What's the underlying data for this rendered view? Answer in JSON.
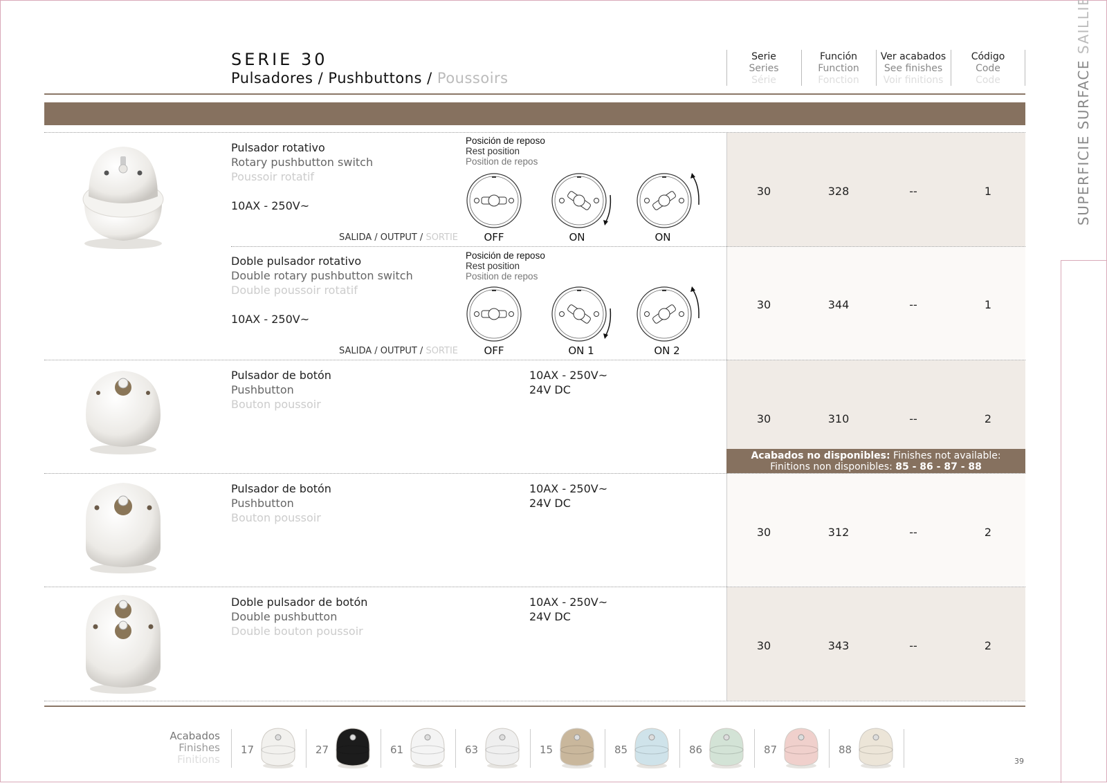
{
  "header": {
    "title": "SERIE 30",
    "subtitle_es": "Pulsadores",
    "subtitle_en": "Pushbuttons",
    "subtitle_fr": "Poussoirs",
    "sep": " / "
  },
  "columns": [
    {
      "es": "Serie",
      "en": "Series",
      "fr": "Série"
    },
    {
      "es": "Función",
      "en": "Function",
      "fr": "Fonction"
    },
    {
      "es": "Ver acabados",
      "en": "See finishes",
      "fr": "Voir finitions"
    },
    {
      "es": "Código",
      "en": "Code",
      "fr": "Code"
    }
  ],
  "side_label": {
    "es": "SUPERFICIE",
    "en": "SURFACE",
    "fr": "SAILLIE"
  },
  "rest_position": {
    "es": "Posición de reposo",
    "en": "Rest position",
    "fr": "Position de repos"
  },
  "output_label": {
    "es": "SALIDA",
    "en": "OUTPUT",
    "fr": "SORTIE"
  },
  "products": [
    {
      "es": "Pulsador rotativo",
      "en": "Rotary pushbutton switch",
      "fr": "Poussoir rotatif",
      "rating": "10AX - 250V~",
      "positions": [
        "OFF",
        "ON",
        "ON"
      ],
      "serie": "30",
      "funcion": "328",
      "acabados": "--",
      "codigo": "1"
    },
    {
      "es": "Doble pulsador rotativo",
      "en": "Double rotary pushbutton switch",
      "fr": "Double poussoir rotatif",
      "rating": "10AX - 250V~",
      "positions": [
        "OFF",
        "ON 1",
        "ON 2"
      ],
      "serie": "30",
      "funcion": "344",
      "acabados": "--",
      "codigo": "1"
    },
    {
      "es": "Pulsador de botón",
      "en": "Pushbutton",
      "fr": "Bouton poussoir",
      "spec1": "10AX - 250V~",
      "spec2": "24V DC",
      "serie": "30",
      "funcion": "310",
      "acabados": "--",
      "codigo": "2"
    },
    {
      "es": "Pulsador de botón",
      "en": "Pushbutton",
      "fr": "Bouton poussoir",
      "spec1": "10AX - 250V~",
      "spec2": "24V DC",
      "serie": "30",
      "funcion": "312",
      "acabados": "--",
      "codigo": "2"
    },
    {
      "es": "Doble pulsador de botón",
      "en": "Double pushbutton",
      "fr": "Double bouton poussoir",
      "spec1": "10AX - 250V~",
      "spec2": "24V DC",
      "serie": "30",
      "funcion": "343",
      "acabados": "--",
      "codigo": "2"
    }
  ],
  "note": {
    "bold1": "Acabados no disponibles:",
    "text1": " Finishes not available:",
    "text2": "Finitions non disponibles: ",
    "bold2": "85 - 86 - 87 - 88"
  },
  "finishes_label": {
    "es": "Acabados",
    "en": "Finishes",
    "fr": "Finitions"
  },
  "finishes": [
    {
      "code": "17",
      "color": "#f2f1ee"
    },
    {
      "code": "27",
      "color": "#1c1c1c"
    },
    {
      "code": "61",
      "color": "#f4f4f4"
    },
    {
      "code": "63",
      "color": "#efefef"
    },
    {
      "code": "15",
      "color": "#c9b79c"
    },
    {
      "code": "85",
      "color": "#cfe3ea"
    },
    {
      "code": "86",
      "color": "#d3e3d6"
    },
    {
      "code": "87",
      "color": "#f0d0cc"
    },
    {
      "code": "88",
      "color": "#ece5d8"
    }
  ],
  "page_number": "39",
  "colors": {
    "accent": "#86715f",
    "shade": "#f0ebe6"
  }
}
